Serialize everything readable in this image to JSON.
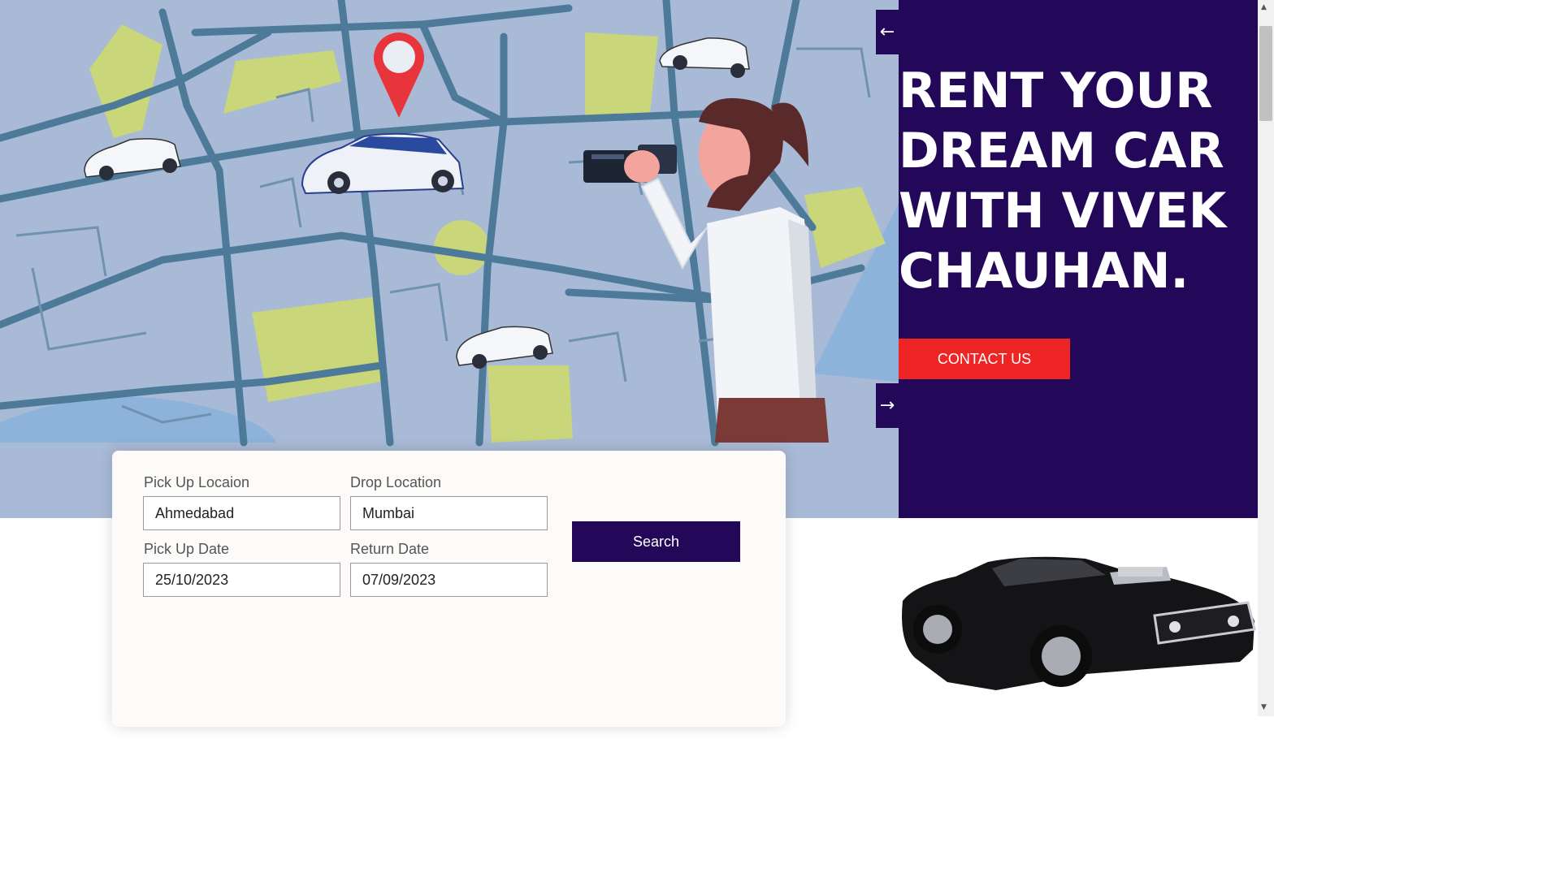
{
  "hero": {
    "headline": "RENT YOUR DREAM CAR WITH VIVEK CHAUHAN.",
    "contact_label": "CONTACT US",
    "prev_arrow": "←",
    "next_arrow": "→",
    "panel_color": "#23085a",
    "accent_color": "#ee2425",
    "map_bg_color": "#a9bad6"
  },
  "search_form": {
    "pickup_location": {
      "label": "Pick Up Locaion",
      "value": "Ahmedabad"
    },
    "drop_location": {
      "label": "Drop Location",
      "value": "Mumbai"
    },
    "pickup_date": {
      "label": "Pick Up Date",
      "value": "25/10/2023"
    },
    "return_date": {
      "label": "Return Date",
      "value": "07/09/2023"
    },
    "search_label": "Search"
  },
  "icons": {
    "map_pin": "map-pin-icon",
    "car": "car-icon",
    "binoculars": "binoculars-icon"
  },
  "scrollbar": {
    "up": "▲",
    "down": "▼"
  }
}
